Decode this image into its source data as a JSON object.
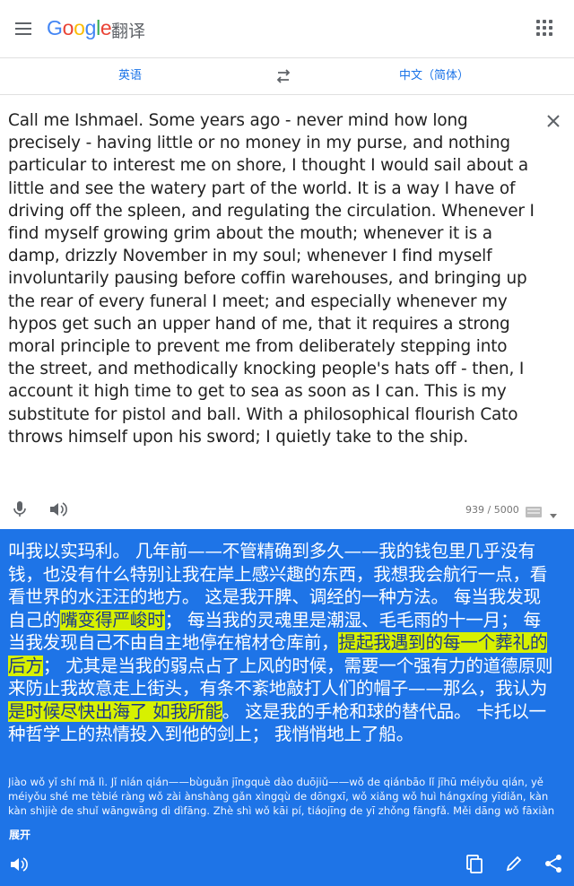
{
  "header": {
    "product_name": "翻译",
    "menu_icon": "hamburger-menu-icon",
    "apps_icon": "apps-grid-icon"
  },
  "languages": {
    "source": "英语",
    "target": "中文（简体）",
    "swap_icon": "swap-arrows-icon"
  },
  "source": {
    "text": "Call me Ishmael. Some years ago - never mind how long precisely - having little or no money in my purse, and nothing particular to interest me on shore, I thought I would sail about a little and see the watery part of the world. It is a way I have of driving off the spleen, and regulating the circulation. Whenever I find myself growing grim about the mouth; whenever it is a damp, drizzly November in my soul; whenever I find myself involuntarily pausing before coffin warehouses, and bringing up the rear of every funeral I meet; and especially whenever my hypos get such an upper hand of me, that it requires a strong moral principle to prevent me from deliberately stepping into the street, and methodically knocking people's hats off - then, I account it high time to get to sea as soon as I can. This is my substitute for pistol and ball. With a philosophical flourish Cato throws himself upon his sword; I quietly take to the ship.",
    "char_count": "939 / 5000"
  },
  "result": {
    "segments": [
      {
        "text": "叫我以实玛利。 几年前——不管精确到多久——我的钱包里几乎没有钱，也没有什么特别让我在岸上感兴趣的东西，我想我会航行一点，看看世界的水汪汪的地方。 这是我开脾、调经的一种方法。 每当我发现自己的",
        "hl": false
      },
      {
        "text": "嘴变得严峻时",
        "hl": true
      },
      {
        "text": "； 每当我的灵魂里是潮湿、毛毛雨的十一月； 每当我发现自己不由自主地停在棺材仓库前，",
        "hl": false
      },
      {
        "text": "提起我遇到的每一个葬礼的后方",
        "hl": true
      },
      {
        "text": "； 尤其是当我的弱点占了上风的时候，需要一个强有力的道德原则来防止我故意走上街头，有条不紊地敲打人们的帽子——那么，我认为",
        "hl": false
      },
      {
        "text": "是时候尽快出海了 如我所能",
        "hl": true
      },
      {
        "text": "。 这是我的手枪和球的替代品。 卡托以一种哲学上的热情投入到他的剑上； 我悄悄地上了船。",
        "hl": false
      }
    ],
    "romanization": "Jiào wǒ yǐ shí mǎ lì. Jǐ nián qián——bùguǎn jīngquè dào duōjiǔ——wǒ de qiánbāo lǐ jīhū méiyǒu qián, yě méiyǒu shé me tèbié ràng wǒ zài ànshàng gǎn xìngqù de dōngxī, wǒ xiǎng wǒ huì hángxíng yīdiǎn, kàn kàn shìjiè de shuǐ wāngwāng dì dìfāng. Zhè shì wǒ kāi pí, tiáojīng de yī zhǒng fāngfǎ. Měi dāng wǒ fāxiàn zìjǐ de",
    "expand_label": "展开"
  },
  "colors": {
    "result_bg": "#1e74e7",
    "highlight": "#d7f100",
    "accent": "#1a73e8"
  }
}
